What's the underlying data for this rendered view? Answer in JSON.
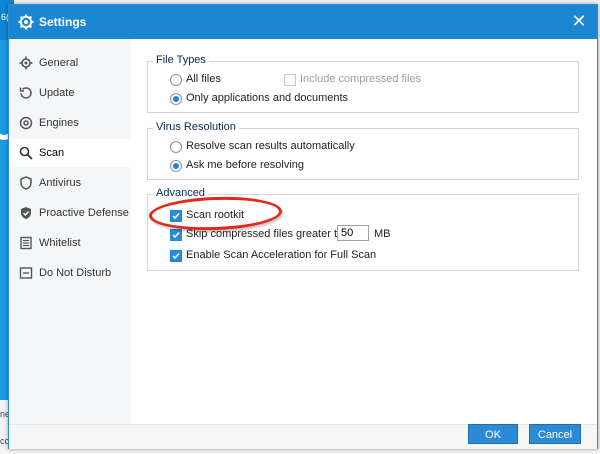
{
  "window": {
    "title": "Settings",
    "close_symbol": "✕"
  },
  "background_fragments": {
    "top_left": "6(",
    "mid_left": "ne",
    "bottom_left": "co"
  },
  "sidebar": {
    "items": [
      {
        "label": "General",
        "icon": "gear-icon"
      },
      {
        "label": "Update",
        "icon": "update-icon"
      },
      {
        "label": "Engines",
        "icon": "engine-icon"
      },
      {
        "label": "Scan",
        "icon": "search-icon",
        "active": true
      },
      {
        "label": "Antivirus",
        "icon": "shield-icon"
      },
      {
        "label": "Proactive Defense",
        "icon": "shield-check-icon"
      },
      {
        "label": "Whitelist",
        "icon": "list-icon"
      },
      {
        "label": "Do Not Disturb",
        "icon": "do-not-disturb-icon"
      }
    ]
  },
  "file_types": {
    "legend": "File Types",
    "all_files": "All files",
    "include_compressed": "Include compressed files",
    "only_apps_docs": "Only applications and documents"
  },
  "virus_resolution": {
    "legend": "Virus Resolution",
    "resolve_auto": "Resolve scan results automatically",
    "ask_me": "Ask me before resolving"
  },
  "advanced": {
    "legend": "Advanced",
    "scan_rootkit": "Scan rootkit",
    "skip_compressed": "Skip compressed files greater than",
    "skip_size_value": "50",
    "skip_size_unit": "MB",
    "scan_acceleration": "Enable Scan Acceleration for Full Scan"
  },
  "buttons": {
    "ok": "OK",
    "cancel": "Cancel"
  },
  "colors": {
    "accent": "#1b86d1",
    "highlight": "#e0281d"
  }
}
